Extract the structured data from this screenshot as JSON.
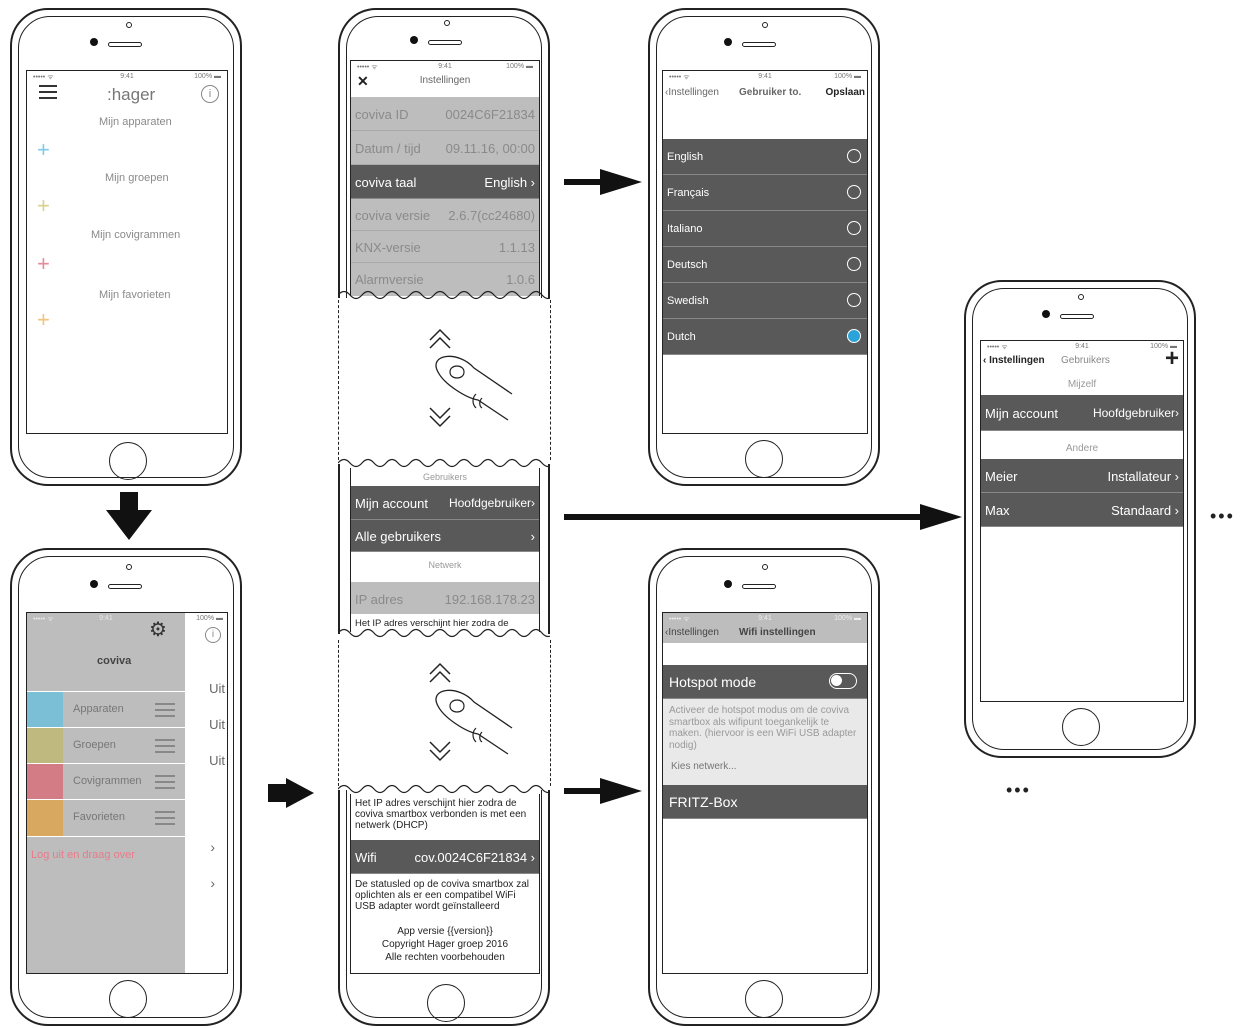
{
  "status": {
    "carrier": "••••• ᯤ",
    "time": "9:41",
    "battery": "100% ▬"
  },
  "home": {
    "logo": ":hager",
    "sections": [
      {
        "label": "Mijn apparaten",
        "color": "#7fcbe8"
      },
      {
        "label": "Mijn groepen",
        "color": "#d9d08b"
      },
      {
        "label": "Mijn covigrammen",
        "color": "#e58a98"
      },
      {
        "label": "Mijn favorieten",
        "color": "#f2c27a"
      }
    ],
    "plus": "+"
  },
  "menu": {
    "title": "coviva",
    "items": [
      {
        "label": "Apparaten",
        "color": "#7bbfd6"
      },
      {
        "label": "Groepen",
        "color": "#bfb97f"
      },
      {
        "label": "Covigrammen",
        "color": "#d47c86"
      },
      {
        "label": "Favorieten",
        "color": "#d8a860"
      }
    ],
    "logout": "Log uit en draag over",
    "right_values": [
      "Uit",
      "Uit",
      "Uit"
    ]
  },
  "settings": {
    "close": "✕",
    "title": "Instellingen",
    "rows": [
      {
        "label": "coviva ID",
        "value": "0024C6F21834"
      },
      {
        "label": "Datum / tijd",
        "value": "09.11.16, 00:00"
      },
      {
        "label": "coviva taal",
        "value": "English ›"
      },
      {
        "label": "coviva versie",
        "value": "2.6.7(cc24680)"
      },
      {
        "label": "KNX-versie",
        "value": "1.1.13"
      },
      {
        "label": "Alarmversie",
        "value": "1.0.6"
      }
    ],
    "users_header": "Gebruikers",
    "my_account": {
      "label": "Mijn account",
      "value": "Hoofdgebruiker›"
    },
    "all_users": {
      "label": "Alle gebruikers",
      "value": "›"
    },
    "network_header": "Netwerk",
    "ip": {
      "label": "IP adres",
      "value": "192.168.178.23"
    },
    "ip_note": "Het IP adres verschijnt hier zodra de",
    "ip_note_full": "Het IP adres verschijnt hier zodra de coviva smartbox verbonden is met een netwerk (DHCP)",
    "wifi": {
      "label": "Wifi",
      "value": "cov.0024C6F21834 ›"
    },
    "led_note": "De statusled op de coviva smartbox zal oplichten als er een compatibel WiFi USB adapter wordt geïnstalleerd",
    "app_version": "App versie {{version}}",
    "copyright": "Copyright Hager groep 2016",
    "rights": "Alle rechten voorbehouden"
  },
  "language": {
    "back": "‹Instellingen",
    "title": "Gebruiker to.",
    "save": "Opslaan",
    "options": [
      "English",
      "Français",
      "Italiano",
      "Deutsch",
      "Swedish",
      "Dutch"
    ],
    "selected": "Dutch"
  },
  "wifi_screen": {
    "back": "‹Instellingen",
    "title": "Wifi instellingen",
    "hotspot": "Hotspot mode",
    "description": "Activeer de hotspot modus om de coviva smartbox als wifipunt toegankelijk te maken. (hiervoor is een WiFi USB adapter nodig)",
    "choose": "Kies netwerk...",
    "network": "FRITZ-Box"
  },
  "users": {
    "back": "‹ Instellingen",
    "title": "Gebruikers",
    "add": "+",
    "self_header": "Mijzelf",
    "my_account": {
      "label": "Mijn account",
      "value": "Hoofdgebruiker›"
    },
    "others_header": "Andere",
    "others": [
      {
        "label": "Meier",
        "value": "Installateur ›"
      },
      {
        "label": "Max",
        "value": "Standaard ›"
      }
    ]
  },
  "ellipsis": "•••",
  "icons": {
    "menu": "hamburger-icon",
    "info": "info-icon",
    "gear": "gear-icon",
    "swipe": "swipe-hand-icon"
  }
}
